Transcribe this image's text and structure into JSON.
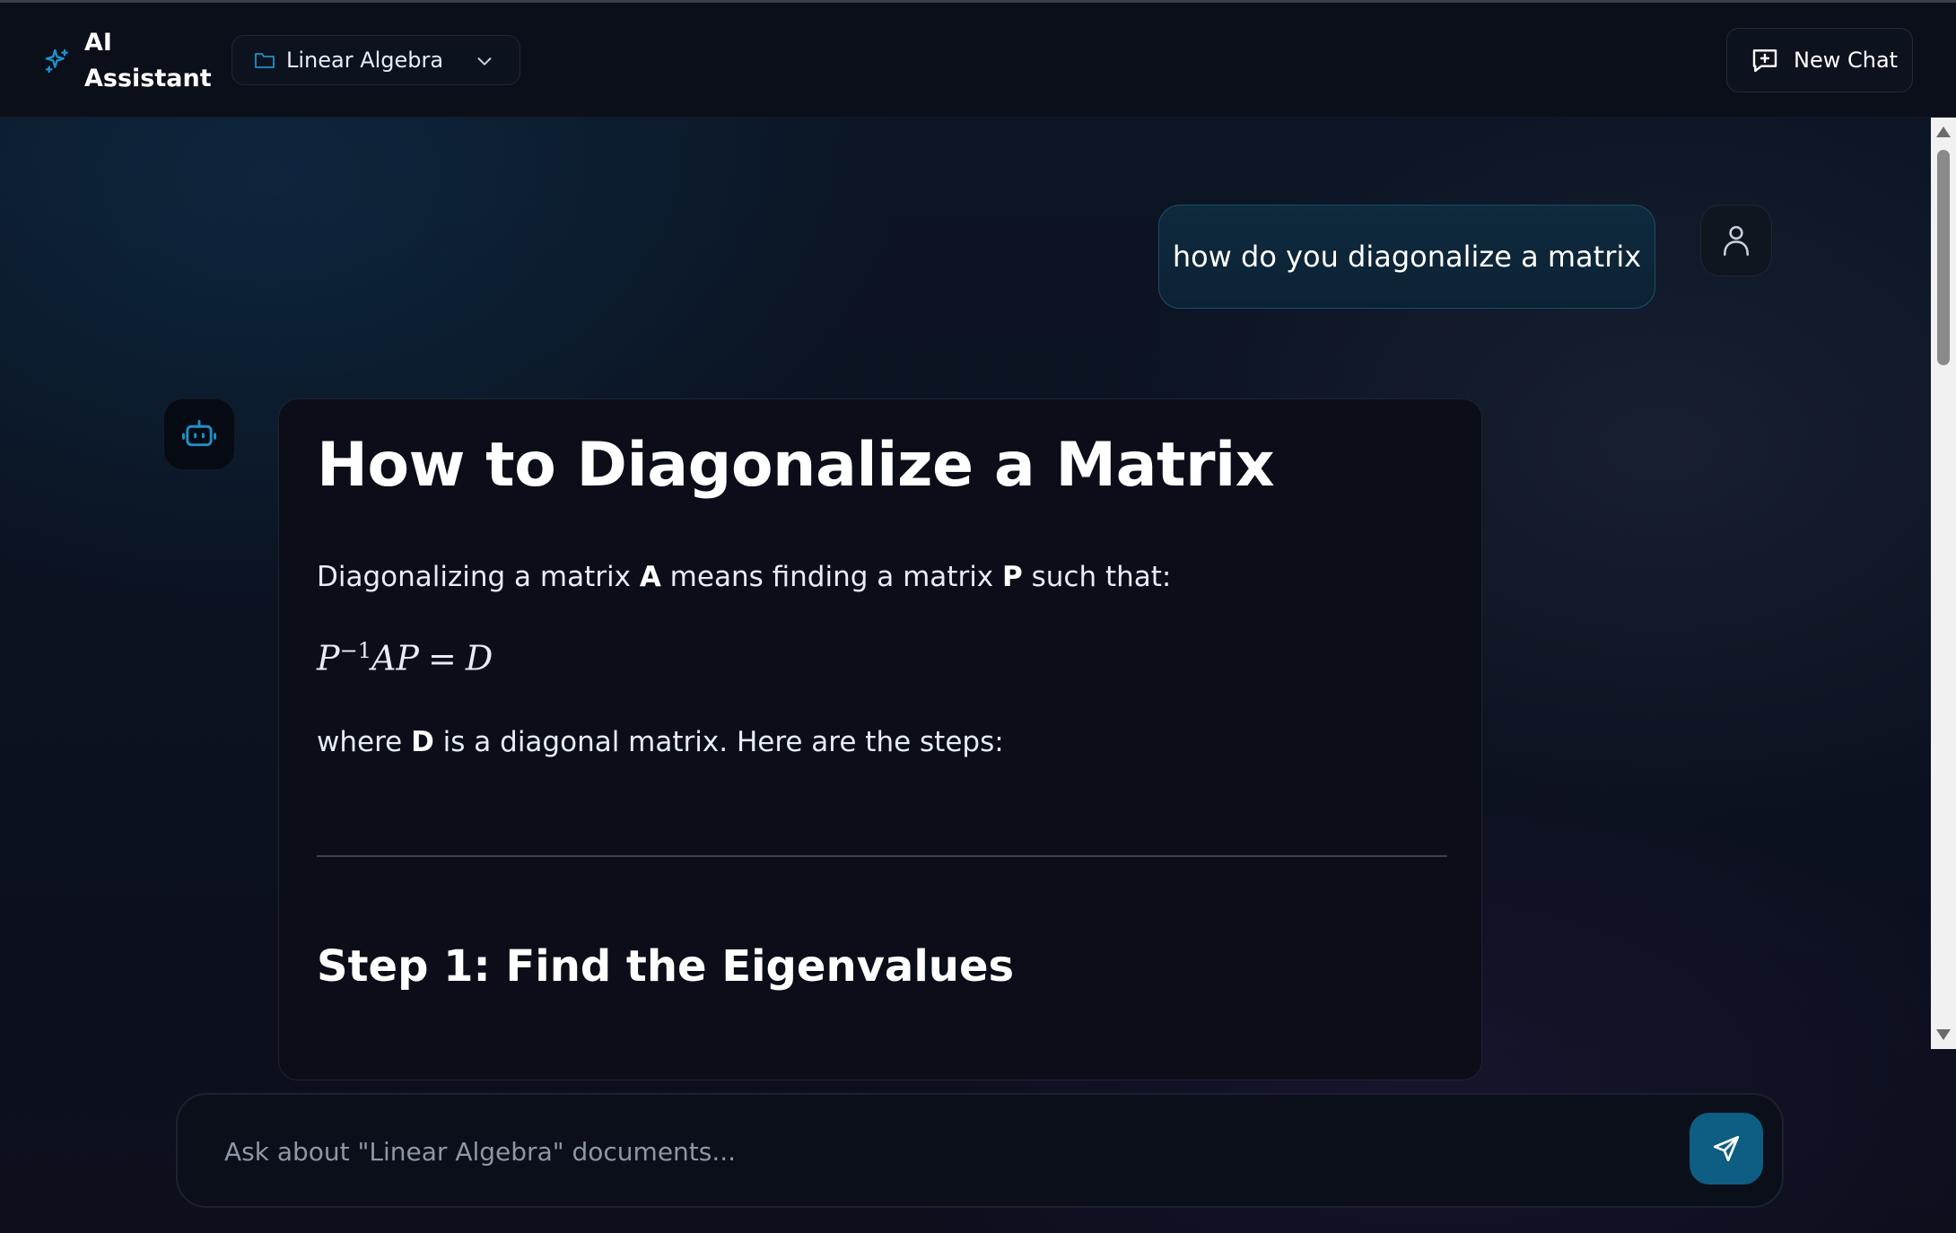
{
  "header": {
    "brand_line1": "AI",
    "brand_line2": "Assistant",
    "collection_label": "Linear Algebra",
    "new_chat_label": "New Chat"
  },
  "conversation": {
    "user_message": "how do you diagonalize a matrix",
    "answer": {
      "title": "How to Diagonalize a Matrix",
      "p1_a": "Diagonalizing a matrix ",
      "p1_b": "A",
      "p1_c": " means finding a matrix ",
      "p1_d": "P",
      "p1_e": " such that:",
      "formula_left": "P",
      "formula_sup": "−1",
      "formula_mid": "AP",
      "formula_eq": "=",
      "formula_right": "D",
      "p3_a": "where ",
      "p3_b": "D",
      "p3_c": " is a diagonal matrix. Here are the steps:",
      "step1_heading": "Step 1: Find the Eigenvalues"
    }
  },
  "input": {
    "placeholder": "Ask about \"Linear Algebra\" documents..."
  },
  "icons": {
    "brand": "sparkles-icon",
    "collection": "folder-icon",
    "dropdown": "chevron-down-icon",
    "new_chat": "message-plus-icon",
    "user": "user-icon",
    "bot": "bot-icon",
    "send": "send-icon"
  },
  "colors": {
    "accent": "#1e90c8",
    "send_button": "#0e5d82",
    "user_bubble_border": "#1f4e6a"
  }
}
